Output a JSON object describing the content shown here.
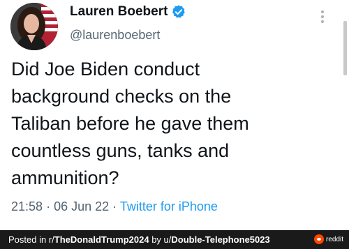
{
  "tweet": {
    "author_name": "Lauren Boebert",
    "author_handle": "@laurenboebert",
    "text_lines": [
      "Did Joe Biden conduct",
      "background checks on the",
      "Taliban before he gave them",
      "countless guns, tanks and",
      "ammunition?"
    ],
    "time": "21:58",
    "date": "06 Jun 22",
    "separator": "·",
    "source": "Twitter for iPhone",
    "verified_icon": "verified-badge-icon",
    "more_icon": "more-options-icon",
    "colors": {
      "text": "#0f1419",
      "secondary": "#536471",
      "link": "#1d9bf0",
      "verified": "#1d9bf0"
    }
  },
  "footer": {
    "prefix": "Posted in r/",
    "subreddit": "TheDonaldTrump2024",
    "by": " by u/",
    "username": "Double-Telephone5023",
    "badge_label": "reddit",
    "colors": {
      "background": "#1a1a1b",
      "badge": "#ff4500"
    }
  }
}
